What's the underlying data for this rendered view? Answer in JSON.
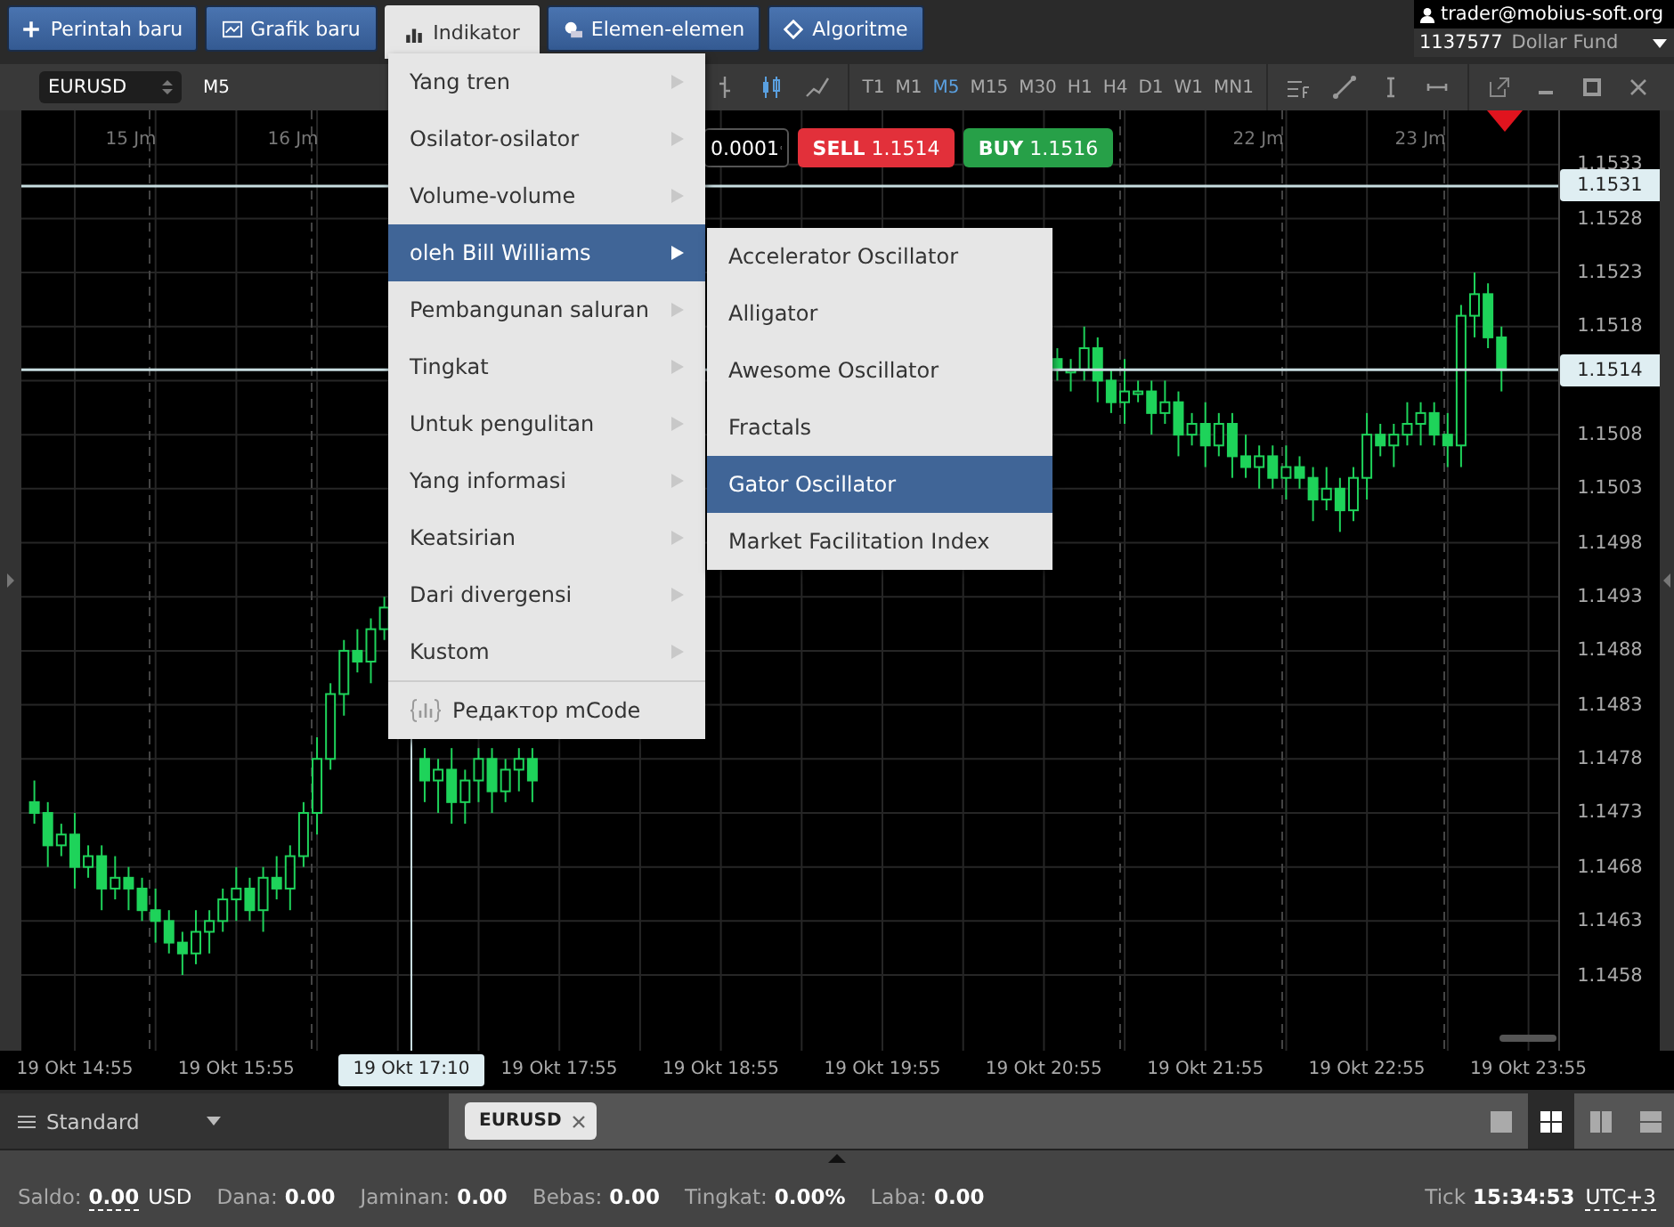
{
  "top_bar": {
    "buttons": [
      {
        "label": "Perintah baru",
        "selected": false
      },
      {
        "label": "Grafik baru",
        "selected": false
      },
      {
        "label": "Indikator",
        "selected": true
      },
      {
        "label": "Elemen-elemen",
        "selected": false
      },
      {
        "label": "Algoritme",
        "selected": false
      }
    ],
    "account": {
      "email": "trader@mobius-soft.org",
      "number": "1137577",
      "fund": "Dollar Fund"
    }
  },
  "chart": {
    "symbol": "EURUSD",
    "timeframe": "M5",
    "lot": "0.0001",
    "sell": {
      "label": "SELL",
      "price": "1.1514"
    },
    "buy": {
      "label": "BUY",
      "price": "1.1516"
    },
    "timeframes": [
      {
        "label": "T1",
        "selected": false
      },
      {
        "label": "M1",
        "selected": false
      },
      {
        "label": "M5",
        "selected": true
      },
      {
        "label": "M15",
        "selected": false
      },
      {
        "label": "M30",
        "selected": false
      },
      {
        "label": "H1",
        "selected": false
      },
      {
        "label": "H4",
        "selected": false
      },
      {
        "label": "D1",
        "selected": false
      },
      {
        "label": "W1",
        "selected": false
      },
      {
        "label": "MN1",
        "selected": false
      }
    ],
    "day_labels_left": [
      "15 Jm",
      "16 Jm"
    ],
    "day_labels_right": [
      "22 Jm",
      "23 Jm"
    ],
    "cursor_time": "19 Okt 17:10",
    "chart_data": {
      "type": "candlestick",
      "grid": true,
      "ylim": [
        1.1451,
        1.1538
      ],
      "yticks": [
        1.1533,
        1.1528,
        1.1523,
        1.1518,
        1.1508,
        1.1503,
        1.1498,
        1.1493,
        1.1488,
        1.1483,
        1.1478,
        1.1473,
        1.1468,
        1.1463,
        1.1458
      ],
      "ref_lines": [
        {
          "axis": "y",
          "value": 1.1531,
          "label": "1.1531"
        },
        {
          "axis": "y",
          "value": 1.1514,
          "label": "1.1514"
        }
      ],
      "categories": [
        null,
        null,
        null,
        "19 Okt 14:55",
        null,
        null,
        null,
        null,
        null,
        null,
        null,
        null,
        null,
        null,
        null,
        "19 Okt 15:55",
        null,
        null,
        null,
        null,
        null,
        null,
        null,
        null,
        null,
        null,
        null,
        null,
        null,
        null,
        null,
        null,
        null,
        null,
        null,
        null,
        null,
        null,
        null,
        "19 Okt 17:55",
        null,
        null,
        null,
        null,
        null,
        null,
        null,
        null,
        null,
        null,
        null,
        "19 Okt 18:55",
        null,
        null,
        null,
        null,
        null,
        null,
        null,
        null,
        null,
        null,
        null,
        "19 Okt 19:55",
        null,
        null,
        null,
        null,
        null,
        null,
        null,
        null,
        null,
        null,
        null,
        "19 Okt 20:55",
        null,
        null,
        null,
        null,
        null,
        null,
        null,
        null,
        null,
        null,
        null,
        "19 Okt 21:55",
        null,
        null,
        null,
        null,
        null,
        null,
        null,
        null,
        null,
        null,
        null,
        "19 Okt 22:55",
        null,
        null,
        null,
        null,
        null,
        null,
        null,
        null,
        null,
        null,
        null,
        "19 Okt 23:55"
      ],
      "ohlc": [
        [
          1.1474,
          1.1476,
          1.1472,
          1.1473
        ],
        [
          1.1473,
          1.1474,
          1.1468,
          1.147
        ],
        [
          1.147,
          1.1472,
          1.1469,
          1.1471
        ],
        [
          1.1471,
          1.1473,
          1.1466,
          1.1468
        ],
        [
          1.1468,
          1.147,
          1.1467,
          1.1469
        ],
        [
          1.1469,
          1.147,
          1.1464,
          1.1466
        ],
        [
          1.1466,
          1.1469,
          1.1465,
          1.1467
        ],
        [
          1.1467,
          1.1468,
          1.1464,
          1.1466
        ],
        [
          1.1466,
          1.1467,
          1.1463,
          1.1464
        ],
        [
          1.1464,
          1.1466,
          1.1461,
          1.1463
        ],
        [
          1.1463,
          1.1464,
          1.146,
          1.1461
        ],
        [
          1.1461,
          1.1462,
          1.1458,
          1.146
        ],
        [
          1.146,
          1.1464,
          1.1459,
          1.1462
        ],
        [
          1.1462,
          1.1464,
          1.146,
          1.1463
        ],
        [
          1.1463,
          1.1466,
          1.1462,
          1.1465
        ],
        [
          1.1465,
          1.1468,
          1.1463,
          1.1466
        ],
        [
          1.1466,
          1.1467,
          1.1463,
          1.1464
        ],
        [
          1.1464,
          1.1468,
          1.1462,
          1.1467
        ],
        [
          1.1467,
          1.1469,
          1.1465,
          1.1466
        ],
        [
          1.1466,
          1.147,
          1.1464,
          1.1469
        ],
        [
          1.1469,
          1.1474,
          1.1468,
          1.1473
        ],
        [
          1.1473,
          1.148,
          1.1471,
          1.1478
        ],
        [
          1.1478,
          1.1485,
          1.1477,
          1.1484
        ],
        [
          1.1484,
          1.1489,
          1.1482,
          1.1488
        ],
        [
          1.1488,
          1.149,
          1.1486,
          1.1487
        ],
        [
          1.1487,
          1.1491,
          1.1485,
          1.149
        ],
        [
          1.149,
          1.1493,
          1.1489,
          1.1492
        ],
        null,
        null,
        [
          1.1478,
          1.1479,
          1.1474,
          1.1476
        ],
        [
          1.1476,
          1.1478,
          1.1473,
          1.1477
        ],
        [
          1.1477,
          1.1479,
          1.1472,
          1.1474
        ],
        [
          1.1474,
          1.1477,
          1.1472,
          1.1476
        ],
        [
          1.1476,
          1.1479,
          1.1474,
          1.1478
        ],
        [
          1.1478,
          1.1479,
          1.1473,
          1.1475
        ],
        [
          1.1475,
          1.1478,
          1.1474,
          1.1477
        ],
        [
          1.1477,
          1.1479,
          1.1475,
          1.1478
        ],
        [
          1.1478,
          1.1479,
          1.1474,
          1.1476
        ],
        null,
        null,
        null,
        null,
        null,
        null,
        null,
        null,
        null,
        null,
        null,
        null,
        null,
        null,
        null,
        null,
        null,
        null,
        null,
        null,
        null,
        null,
        null,
        null,
        null,
        null,
        null,
        null,
        null,
        null,
        null,
        null,
        null,
        null,
        null,
        null,
        null,
        null,
        [
          1.1515,
          1.1516,
          1.1513,
          1.1514
        ],
        [
          1.1514,
          1.1515,
          1.1512,
          1.1514
        ],
        [
          1.1514,
          1.1518,
          1.1513,
          1.1516
        ],
        [
          1.1516,
          1.1517,
          1.1511,
          1.1513
        ],
        [
          1.1513,
          1.1514,
          1.151,
          1.1511
        ],
        [
          1.1511,
          1.1515,
          1.1509,
          1.1512
        ],
        [
          1.1512,
          1.1513,
          1.1511,
          1.1512
        ],
        [
          1.1512,
          1.1513,
          1.1508,
          1.151
        ],
        [
          1.151,
          1.1513,
          1.1509,
          1.1511
        ],
        [
          1.1511,
          1.1512,
          1.1506,
          1.1508
        ],
        [
          1.1508,
          1.151,
          1.1507,
          1.1509
        ],
        [
          1.1509,
          1.1511,
          1.1505,
          1.1507
        ],
        [
          1.1507,
          1.151,
          1.1506,
          1.1509
        ],
        [
          1.1509,
          1.151,
          1.1504,
          1.1506
        ],
        [
          1.1506,
          1.1508,
          1.1504,
          1.1505
        ],
        [
          1.1505,
          1.1507,
          1.1503,
          1.1506
        ],
        [
          1.1506,
          1.1507,
          1.1503,
          1.1504
        ],
        [
          1.1504,
          1.1507,
          1.1502,
          1.1505
        ],
        [
          1.1505,
          1.1506,
          1.1503,
          1.1504
        ],
        [
          1.1504,
          1.1505,
          1.15,
          1.1502
        ],
        [
          1.1502,
          1.1505,
          1.1501,
          1.1503
        ],
        [
          1.1503,
          1.1504,
          1.1499,
          1.1501
        ],
        [
          1.1501,
          1.1505,
          1.15,
          1.1504
        ],
        [
          1.1504,
          1.151,
          1.1502,
          1.1508
        ],
        [
          1.1508,
          1.1509,
          1.1506,
          1.1507
        ],
        [
          1.1507,
          1.1509,
          1.1505,
          1.1508
        ],
        [
          1.1508,
          1.1511,
          1.1507,
          1.1509
        ],
        [
          1.1509,
          1.1511,
          1.1507,
          1.151
        ],
        [
          1.151,
          1.1511,
          1.1507,
          1.1508
        ],
        [
          1.1508,
          1.151,
          1.1505,
          1.1507
        ],
        [
          1.1507,
          1.152,
          1.1505,
          1.1519
        ],
        [
          1.1519,
          1.1523,
          1.1517,
          1.1521
        ],
        [
          1.1521,
          1.1522,
          1.1516,
          1.1517
        ],
        [
          1.1517,
          1.1518,
          1.1512,
          1.1514
        ],
        null,
        null
      ]
    }
  },
  "indicator_menu": {
    "items": [
      {
        "label": "Yang tren",
        "selected": false
      },
      {
        "label": "Osilator-osilator",
        "selected": false
      },
      {
        "label": "Volume-volume",
        "selected": false
      },
      {
        "label": "oleh Bill Williams",
        "selected": true
      },
      {
        "label": "Pembangunan saluran",
        "selected": false
      },
      {
        "label": "Tingkat",
        "selected": false
      },
      {
        "label": "Untuk pengulitan",
        "selected": false
      },
      {
        "label": "Yang informasi",
        "selected": false
      },
      {
        "label": "Keatsirian",
        "selected": false
      },
      {
        "label": "Dari divergensi",
        "selected": false
      },
      {
        "label": "Kustom",
        "selected": false
      }
    ],
    "footer": "Редактор mCode"
  },
  "submenu": {
    "items": [
      {
        "label": "Accelerator Oscillator",
        "selected": false
      },
      {
        "label": "Alligator",
        "selected": false
      },
      {
        "label": "Awesome Oscillator",
        "selected": false
      },
      {
        "label": "Fractals",
        "selected": false
      },
      {
        "label": "Gator Oscillator",
        "selected": true
      },
      {
        "label": "Market Facilitation Index",
        "selected": false
      }
    ]
  },
  "bottom_bar": {
    "workspace": "Standard",
    "tabs": [
      {
        "label": "EURUSD"
      }
    ],
    "layouts": [
      {
        "selected": false
      },
      {
        "selected": true
      },
      {
        "selected": false
      },
      {
        "selected": false
      }
    ]
  },
  "status_bar": {
    "balance_label": "Saldo:",
    "balance": "0.00",
    "currency": "USD",
    "fields": [
      {
        "label": "Dana:",
        "value": "0.00"
      },
      {
        "label": "Jaminan:",
        "value": "0.00"
      },
      {
        "label": "Bebas:",
        "value": "0.00"
      },
      {
        "label": "Tingkat:",
        "value": "0.00%"
      },
      {
        "label": "Laba:",
        "value": "0.00"
      }
    ],
    "tick_label": "Tick",
    "time": "15:34:53",
    "timezone": "UTC+3"
  }
}
